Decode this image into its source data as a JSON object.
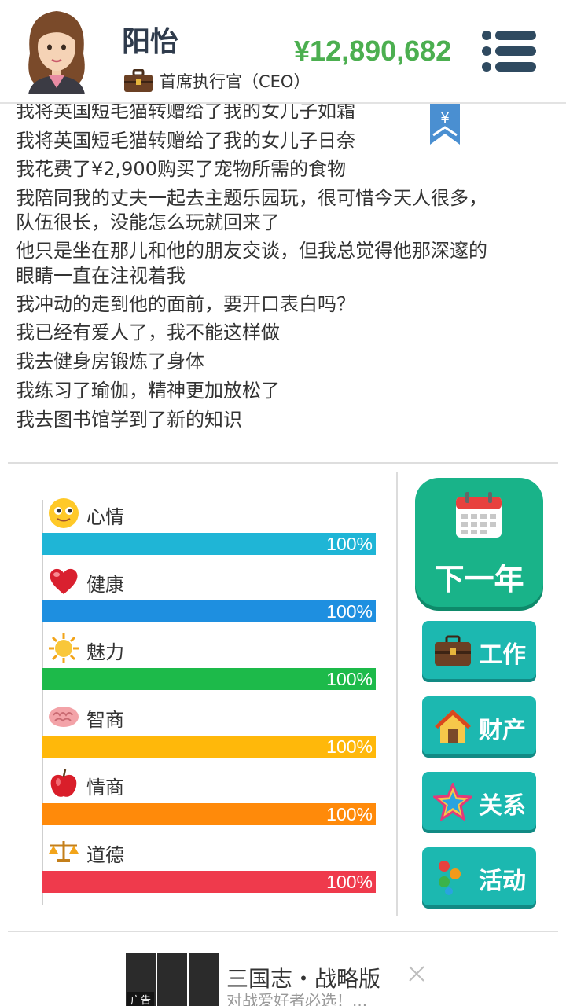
{
  "player": {
    "name": "阳怡",
    "job_title": "首席执行官（CEO）",
    "money": "¥12,890,682"
  },
  "log_lines": [
    "我将英国短毛猫转赠给了我的女儿子如霜",
    "我将英国短毛猫转赠给了我的女儿子日奈",
    "我花费了¥2,900购买了宠物所需的食物",
    "我陪同我的丈夫一起去主题乐园玩，很可惜今天人很多，",
    "队伍很长，没能怎么玩就回来了",
    "他只是坐在那儿和他的朋友交谈，但我总觉得他那深邃的",
    "眼睛一直在注视着我",
    "我冲动的走到他的面前，要开口表白吗？",
    "我已经有爱人了，我不能这样做",
    "我去健身房锻炼了身体",
    "我练习了瑜伽，精神更加放松了",
    "我去图书馆学到了新的知识"
  ],
  "bookmark_symbol": "¥",
  "stats": [
    {
      "label": "心情",
      "value_text": "100%",
      "fraction": 1.0,
      "color": "#1fb5d6",
      "icon": "smiley-icon"
    },
    {
      "label": "健康",
      "value_text": "100%",
      "fraction": 1.0,
      "color": "#1e8fe0",
      "icon": "heart-icon"
    },
    {
      "label": "魅力",
      "value_text": "100%",
      "fraction": 1.0,
      "color": "#1dba4a",
      "icon": "sun-icon"
    },
    {
      "label": "智商",
      "value_text": "100%",
      "fraction": 1.0,
      "color": "#ffb80a",
      "icon": "brain-icon"
    },
    {
      "label": "情商",
      "value_text": "100%",
      "fraction": 1.0,
      "color": "#ff8a0a",
      "icon": "apple-icon"
    },
    {
      "label": "道德",
      "value_text": "100%",
      "fraction": 1.0,
      "color": "#ef3a4c",
      "icon": "scales-icon"
    }
  ],
  "buttons": {
    "next_year": "下一年",
    "work": "工作",
    "property": "财产",
    "relations": "关系",
    "activities": "活动"
  },
  "ad": {
    "tag": "广告",
    "title": "三国志・战略版",
    "subtitle": "对战爱好者必选！..."
  },
  "colors": {
    "money": "#4caf50",
    "next_year_button": "#19b389",
    "side_button": "#1cb8b0"
  }
}
